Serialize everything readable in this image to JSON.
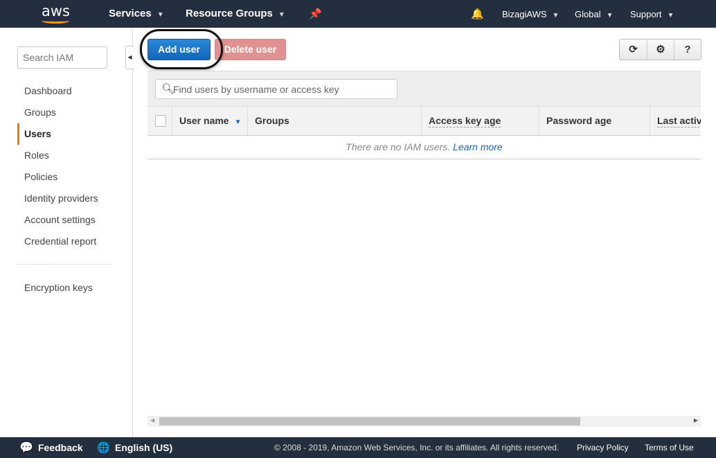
{
  "topnav": {
    "logo": "aws",
    "services": "Services",
    "resource_groups": "Resource Groups",
    "account": "BizagiAWS",
    "region": "Global",
    "support": "Support"
  },
  "sidebar": {
    "search_placeholder": "Search IAM",
    "items": [
      {
        "label": "Dashboard"
      },
      {
        "label": "Groups"
      },
      {
        "label": "Users"
      },
      {
        "label": "Roles"
      },
      {
        "label": "Policies"
      },
      {
        "label": "Identity providers"
      },
      {
        "label": "Account settings"
      },
      {
        "label": "Credential report"
      }
    ],
    "active": "Users",
    "encryption": "Encryption keys"
  },
  "toolbar": {
    "add_user": "Add user",
    "delete_user": "Delete user"
  },
  "filter": {
    "placeholder": "Find users by username or access key"
  },
  "table": {
    "columns": [
      "User name",
      "Groups",
      "Access key age",
      "Password age",
      "Last activity"
    ],
    "empty_text": "There are no IAM users.",
    "learn_more": "Learn more"
  },
  "footer": {
    "feedback": "Feedback",
    "language": "English (US)",
    "copyright": "© 2008 - 2019, Amazon Web Services, Inc. or its affiliates. All rights reserved.",
    "privacy": "Privacy Policy",
    "terms": "Terms of Use"
  },
  "colors": {
    "nav": "#232f3e",
    "primary": "#1166bb",
    "accent": "#ff9900"
  }
}
